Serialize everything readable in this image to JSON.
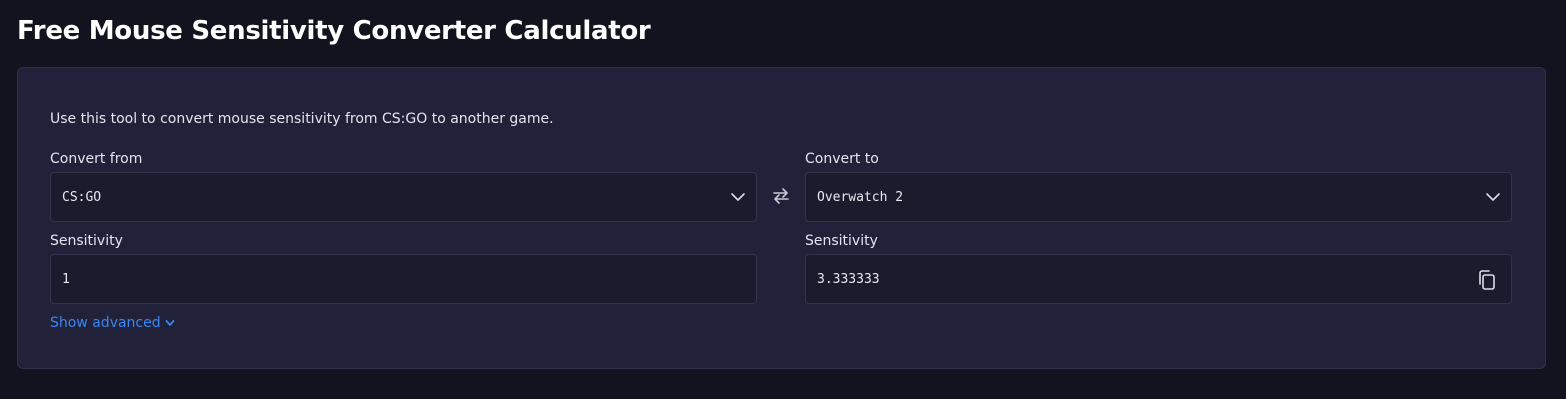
{
  "page": {
    "title": "Free Mouse Sensitivity Converter Calculator"
  },
  "converter": {
    "description": "Use this tool to convert mouse sensitivity from CS:GO to another game.",
    "from": {
      "label": "Convert from",
      "selected_game": "CS:GO",
      "sensitivity_label": "Sensitivity",
      "sensitivity_value": "1"
    },
    "to": {
      "label": "Convert to",
      "selected_game": "Overwatch 2",
      "sensitivity_label": "Sensitivity",
      "sensitivity_value": "3.333333"
    },
    "advanced_toggle": "Show advanced"
  },
  "colors": {
    "background": "#13131f",
    "card": "#21213a",
    "field": "#1b1b2e",
    "link": "#3b86f0"
  },
  "icons": {
    "swap": "swap-arrows-icon",
    "dropdown": "chevron-down-icon",
    "copy": "copy-icon"
  }
}
